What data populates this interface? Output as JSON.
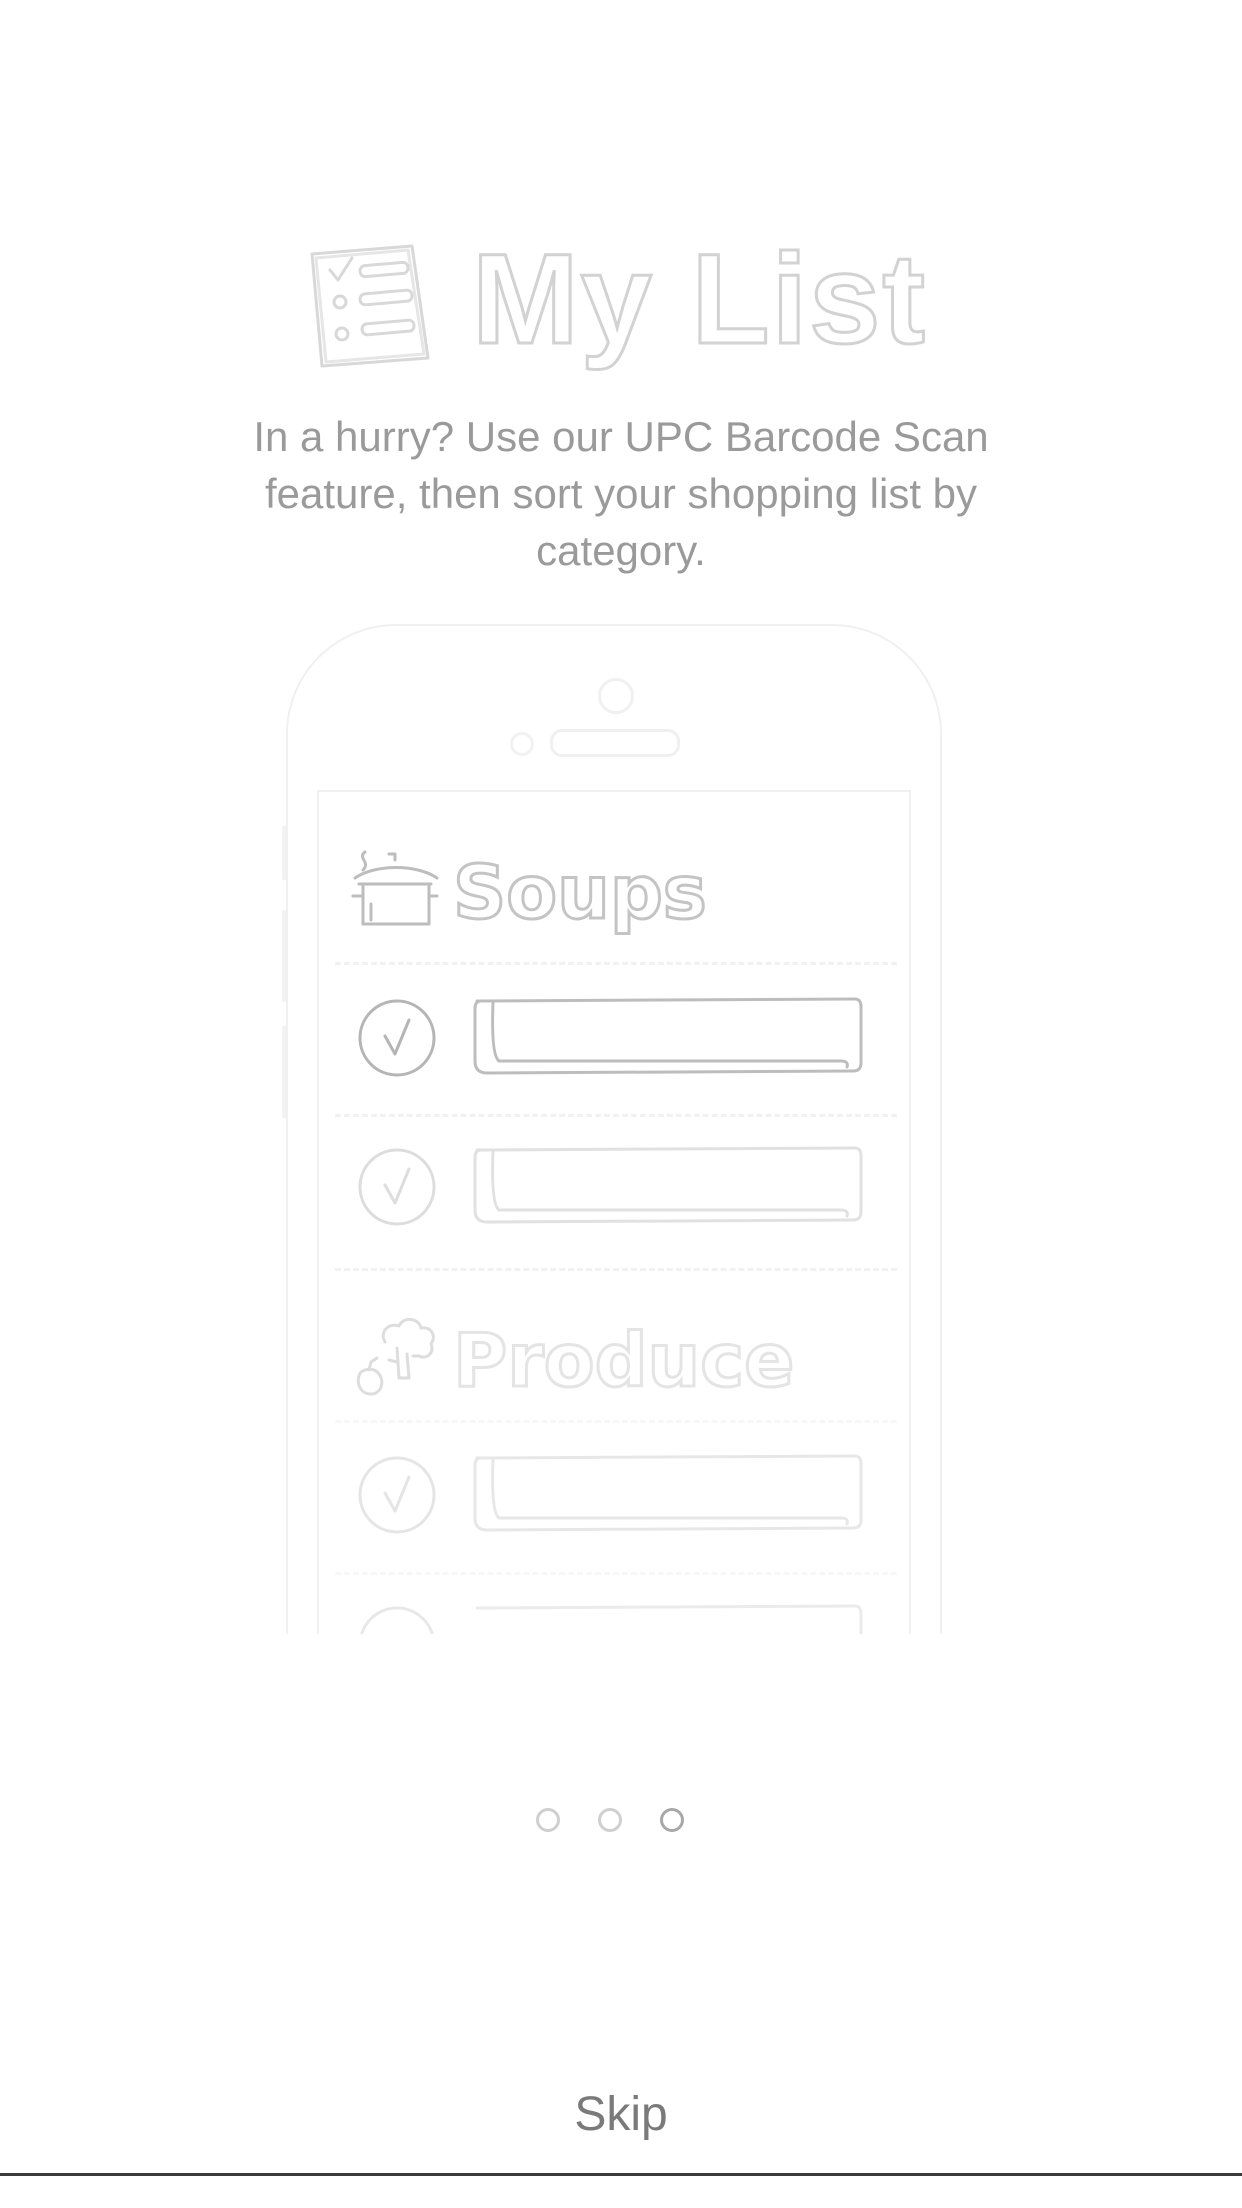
{
  "header": {
    "title": "My List",
    "icon": "checklist-icon"
  },
  "subtitle": "In a hurry? Use our UPC Barcode Scan feature, then sort your shopping list by category.",
  "illustration": {
    "device": "phone-outline",
    "sections": [
      {
        "label": "Soups",
        "icon": "soup-pot-icon"
      },
      {
        "label": "Produce",
        "icon": "produce-icon"
      }
    ]
  },
  "pager": {
    "pages": 3,
    "active_index": 2
  },
  "skip_label": "Skip",
  "colors": {
    "outline_dark": "#bdbdbd",
    "outline_light": "#e6e6e6",
    "text_gray": "#9a9a9a",
    "skip_text": "#7a7a7a"
  }
}
